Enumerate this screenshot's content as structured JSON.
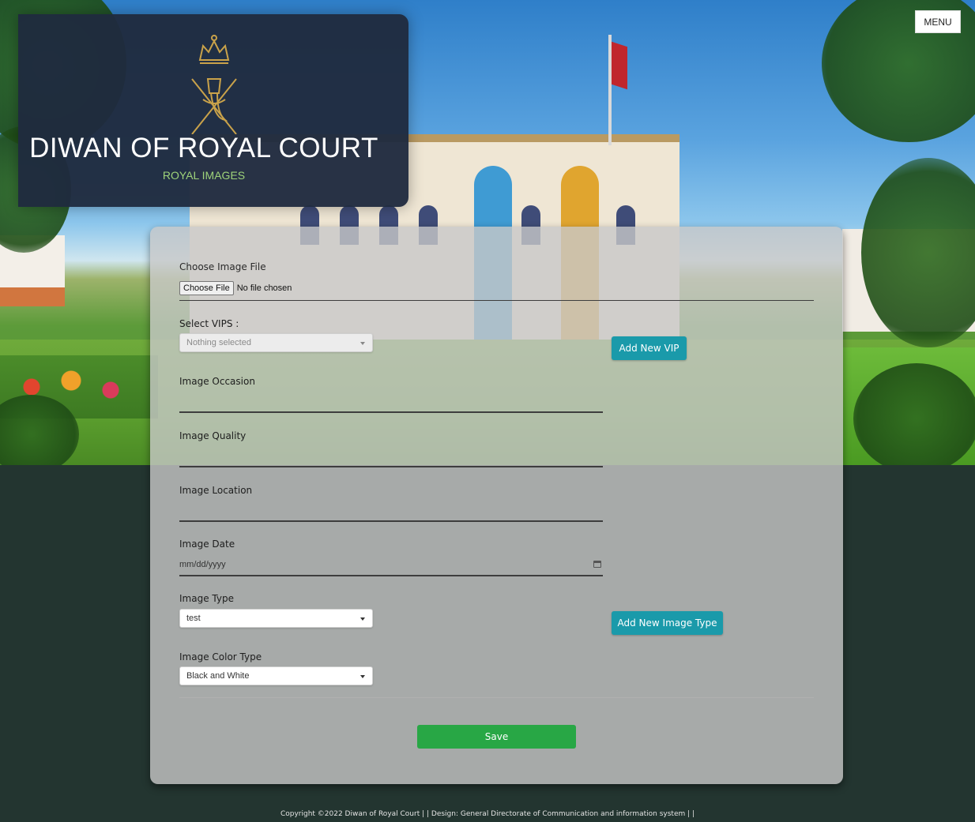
{
  "header": {
    "title": "DIWAN OF ROYAL COURT",
    "subtitle": "ROYAL IMAGES",
    "emblem_icon": "khanjar-crown-emblem-icon",
    "menu_label": "MENU"
  },
  "form": {
    "file": {
      "label": "Choose Image File",
      "button_label": "Choose File",
      "status_text": "No file chosen"
    },
    "vips": {
      "label": "Select VIPS :",
      "placeholder": "Nothing selected",
      "add_button": "Add New VIP"
    },
    "occasion": {
      "label": "Image Occasion",
      "value": ""
    },
    "quality": {
      "label": "Image Quality",
      "value": ""
    },
    "location": {
      "label": "Image Location",
      "value": ""
    },
    "date": {
      "label": "Image Date",
      "placeholder": "mm/dd/yyyy",
      "icon": "calendar-icon"
    },
    "type": {
      "label": "Image Type",
      "selected": "test",
      "add_button": "Add New Image Type"
    },
    "color_type": {
      "label": "Image Color Type",
      "selected": "Black and White"
    },
    "save_label": "Save"
  },
  "footer": {
    "text": "Copyright ©2022 Diwan of Royal Court  | |  Design: General Directorate of Communication and information system  | |"
  },
  "colors": {
    "brand_box": "#1f2b3e",
    "subtitle_green": "#9ed37a",
    "teal_button": "#1a9aaa",
    "save_green": "#28a745",
    "page_background": "#233530"
  }
}
